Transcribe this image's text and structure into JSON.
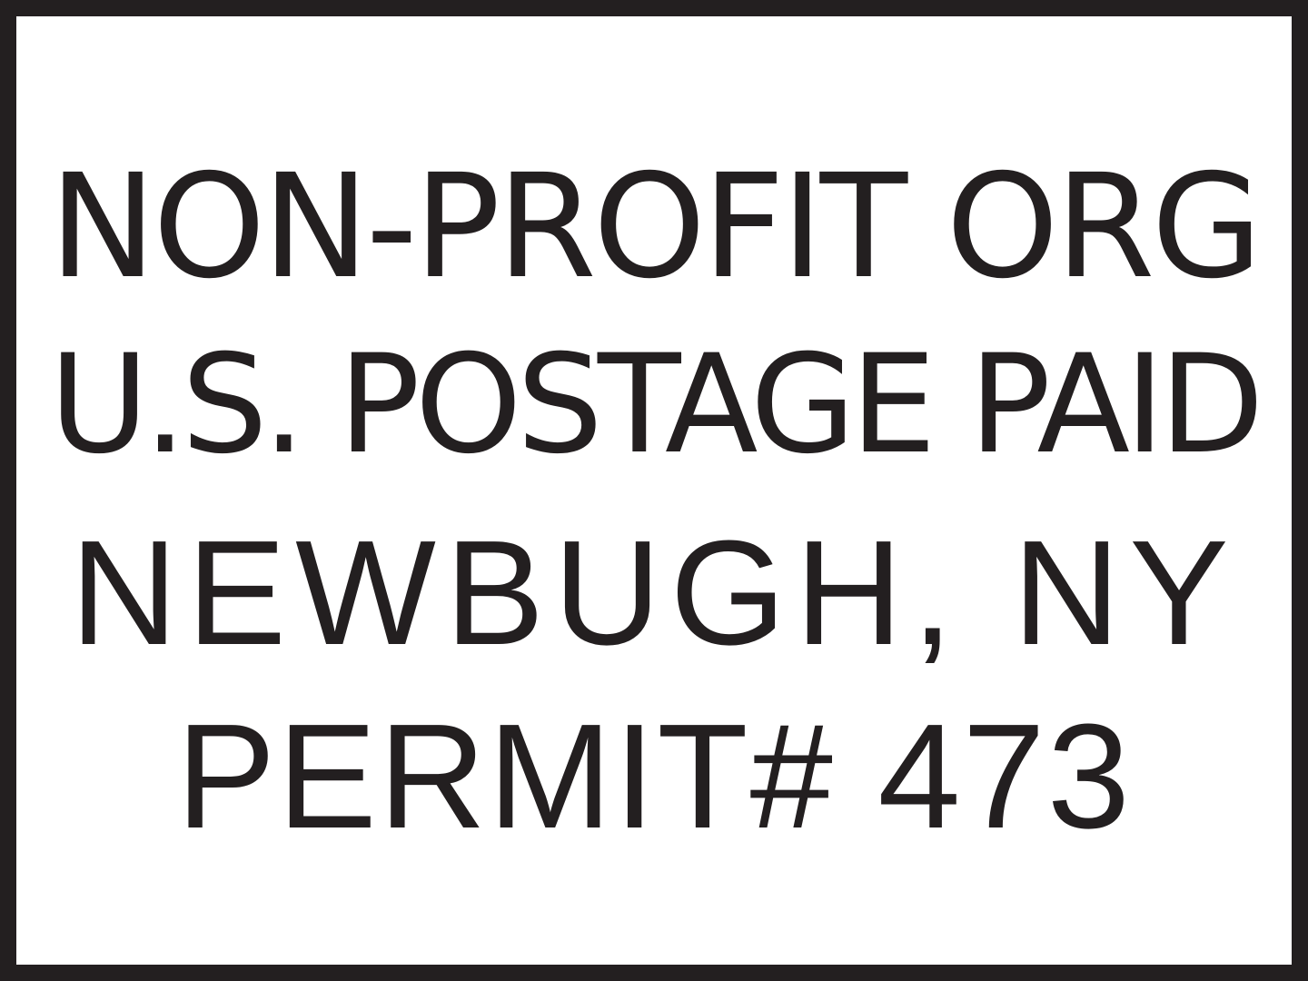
{
  "indicia": {
    "line1": "NON-PROFIT ORG",
    "line2": "U.S. POSTAGE PAID",
    "line3": "NEWBUGH, NY",
    "line4": "PERMIT# 473"
  },
  "colors": {
    "ink": "#231f20",
    "background": "#ffffff"
  }
}
